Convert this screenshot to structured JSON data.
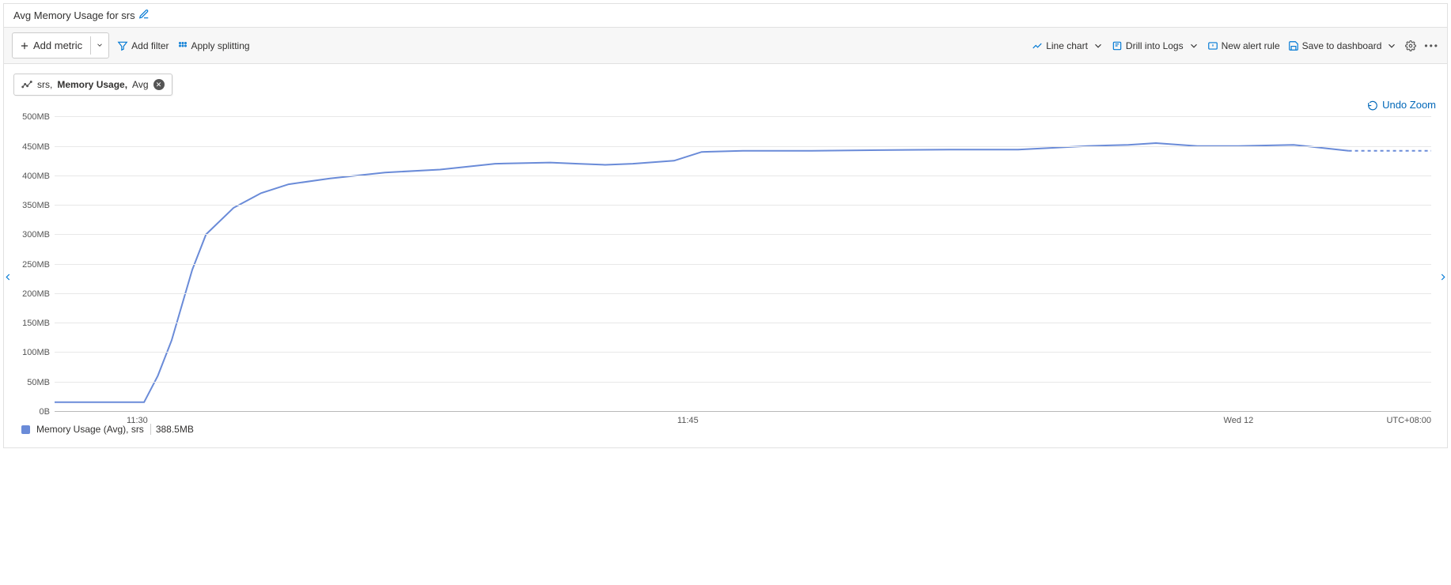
{
  "title": "Avg Memory Usage for srs",
  "toolbar": {
    "add_metric": "Add metric",
    "add_filter": "Add filter",
    "apply_splitting": "Apply splitting",
    "line_chart": "Line chart",
    "drill_logs": "Drill into Logs",
    "new_alert": "New alert rule",
    "save_dash": "Save to dashboard"
  },
  "chip": {
    "resource": "srs,",
    "metric": "Memory Usage,",
    "aggregation": "Avg"
  },
  "undo_zoom": "Undo Zoom",
  "timezone": "UTC+08:00",
  "x_ticks": [
    "11:30",
    "11:45",
    "Wed 12"
  ],
  "legend": {
    "label": "Memory Usage (Avg), srs",
    "value": "388.5MB",
    "color": "#6a8bd8"
  },
  "chart_data": {
    "type": "line",
    "title": "Avg Memory Usage for srs",
    "xlabel": "",
    "ylabel": "",
    "y_ticks": [
      0,
      50,
      100,
      150,
      200,
      250,
      300,
      350,
      400,
      450,
      500
    ],
    "y_tick_labels": [
      "0B",
      "50MB",
      "100MB",
      "150MB",
      "200MB",
      "250MB",
      "300MB",
      "350MB",
      "400MB",
      "450MB",
      "500MB"
    ],
    "ylim": [
      0,
      510
    ],
    "series": [
      {
        "name": "Memory Usage (Avg), srs",
        "color": "#6a8bd8",
        "x_frac": [
          0.0,
          0.04,
          0.065,
          0.075,
          0.085,
          0.1,
          0.11,
          0.13,
          0.15,
          0.17,
          0.2,
          0.24,
          0.28,
          0.32,
          0.36,
          0.38,
          0.4,
          0.42,
          0.45,
          0.47,
          0.5,
          0.55,
          0.6,
          0.65,
          0.7,
          0.75,
          0.78,
          0.8,
          0.83,
          0.86,
          0.9,
          0.94
        ],
        "values": [
          15,
          15,
          15,
          60,
          120,
          240,
          300,
          345,
          370,
          385,
          395,
          405,
          410,
          420,
          422,
          420,
          418,
          420,
          425,
          440,
          442,
          442,
          443,
          444,
          444,
          450,
          452,
          455,
          450,
          450,
          452,
          442
        ],
        "dashed_tail": {
          "x_frac": [
            0.94,
            1.0
          ],
          "values": [
            442,
            442
          ]
        }
      }
    ]
  }
}
